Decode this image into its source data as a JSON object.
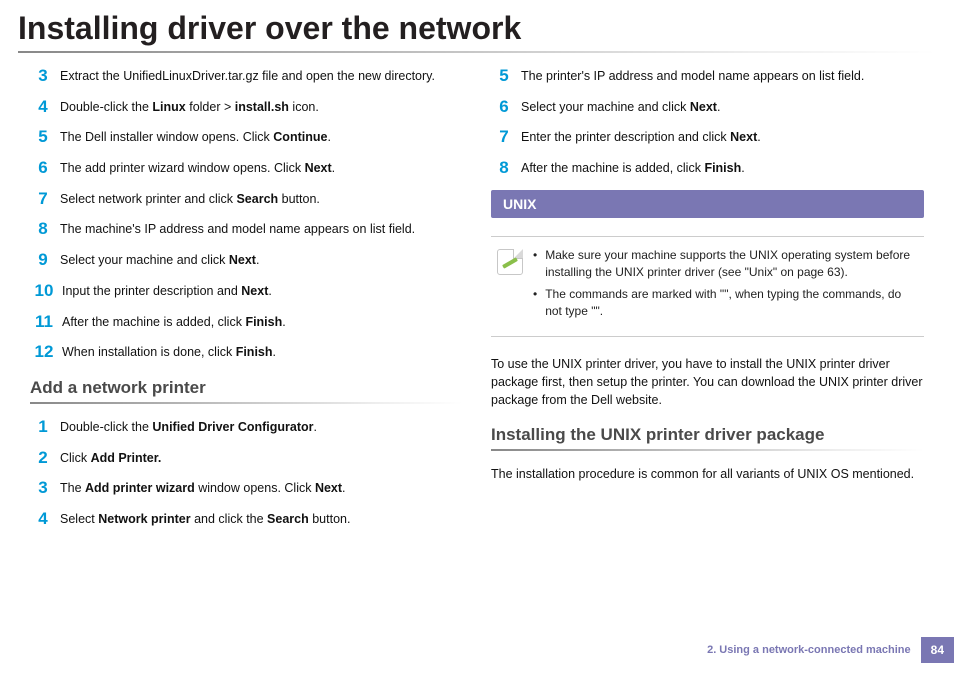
{
  "title": "Installing driver over the network",
  "left_steps_a": [
    {
      "n": "3",
      "html": "Extract the UnifiedLinuxDriver.tar.gz file and open the new directory."
    },
    {
      "n": "4",
      "html": "Double-click the <b>Linux</b> folder > <b>install.sh</b> icon."
    },
    {
      "n": "5",
      "html": "The Dell installer window opens. Click <b>Continue</b>."
    },
    {
      "n": "6",
      "html": "The add printer wizard window opens. Click <b>Next</b>."
    },
    {
      "n": "7",
      "html": "Select network printer and click <b>Search</b> button."
    },
    {
      "n": "8",
      "html": "The machine's IP address and model name appears on list field."
    },
    {
      "n": "9",
      "html": "Select your machine and click <b>Next</b>."
    },
    {
      "n": "10",
      "html": "Input the printer description and <b>Next</b>."
    },
    {
      "n": "11",
      "html": "After the machine is added, click <b>Finish</b>."
    },
    {
      "n": "12",
      "html": "When installation is done, click <b>Finish</b>."
    }
  ],
  "left_subheading": "Add a network printer",
  "left_steps_b": [
    {
      "n": "1",
      "html": "Double-click the <b>Unified Driver Configurator</b>."
    },
    {
      "n": "2",
      "html": "Click <b>Add Printer.</b>"
    },
    {
      "n": "3",
      "html": "The <b>Add printer wizard</b> window opens. Click <b>Next</b>."
    },
    {
      "n": "4",
      "html": "Select <b>Network printer</b> and click the <b>Search</b> button."
    }
  ],
  "right_steps": [
    {
      "n": "5",
      "html": "The printer's IP address and model name appears on list field."
    },
    {
      "n": "6",
      "html": "Select your machine and click <b>Next</b>."
    },
    {
      "n": "7",
      "html": "Enter the printer description and click <b>Next</b>."
    },
    {
      "n": "8",
      "html": "After the machine is added, click <b>Finish</b>."
    }
  ],
  "section_bar": "UNIX",
  "notes": [
    "Make sure your machine supports the UNIX operating system before installing the UNIX printer driver (see \"Unix\" on page 63).",
    "The commands are marked with \"\", when typing the commands, do not type \"\"."
  ],
  "unix_body": "To use the UNIX printer driver, you have to install the UNIX printer driver package first, then setup the printer. You can download the UNIX printer driver package from the Dell website.",
  "unix_subheading": "Installing the UNIX printer driver package",
  "unix_sub_body": "The installation procedure is common for all variants of UNIX OS mentioned.",
  "footer_text": "2.  Using a network-connected machine",
  "page_number": "84"
}
